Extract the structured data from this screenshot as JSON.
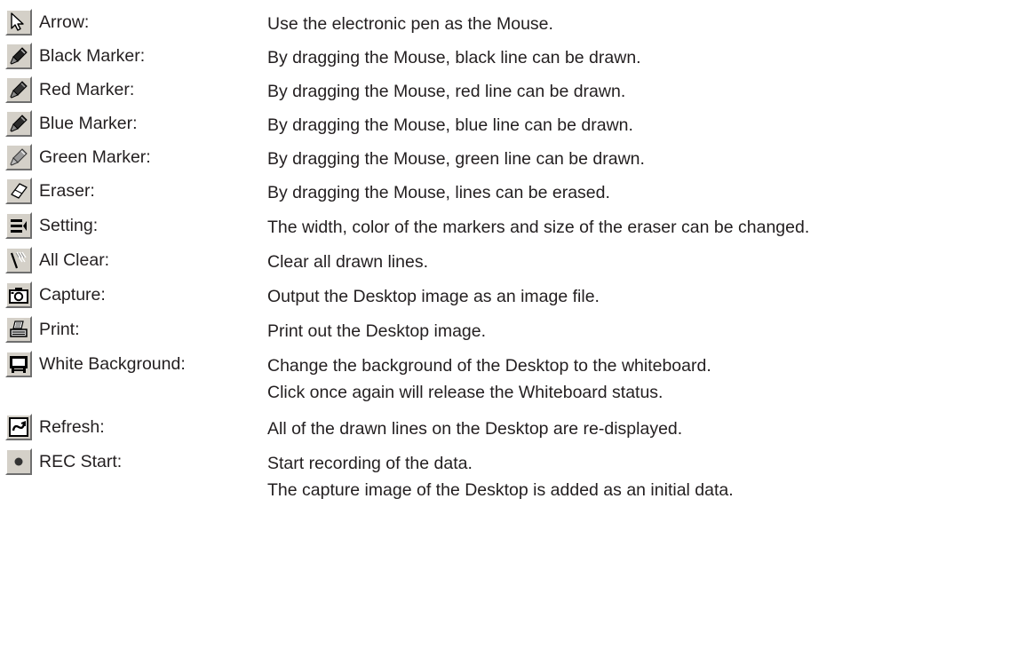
{
  "items": [
    {
      "icon": "arrow-cursor-icon",
      "label": "Arrow:",
      "desc": [
        "Use the electronic pen as the Mouse."
      ]
    },
    {
      "icon": "black-marker-icon",
      "label": "Black Marker:",
      "desc": [
        "By dragging the Mouse, black line can be drawn."
      ]
    },
    {
      "icon": "red-marker-icon",
      "label": "Red Marker:",
      "desc": [
        "By dragging the Mouse, red line can be drawn."
      ]
    },
    {
      "icon": "blue-marker-icon",
      "label": "Blue Marker:",
      "desc": [
        "By dragging the Mouse, blue line can be drawn."
      ]
    },
    {
      "icon": "green-marker-icon",
      "label": "Green Marker:",
      "desc": [
        "By dragging the Mouse, green line can be drawn."
      ]
    },
    {
      "icon": "eraser-icon",
      "label": "Eraser:",
      "desc": [
        "By dragging the Mouse, lines can be erased."
      ]
    },
    {
      "icon": "setting-icon",
      "label": "Setting:",
      "desc": [
        "The width, color of the markers and size of the eraser can be changed."
      ]
    },
    {
      "icon": "all-clear-icon",
      "label": "All Clear:",
      "desc": [
        "Clear all drawn lines."
      ]
    },
    {
      "icon": "camera-icon",
      "label": "Capture:",
      "desc": [
        "Output the Desktop image as an image file."
      ]
    },
    {
      "icon": "printer-icon",
      "label": "Print:",
      "desc": [
        "Print out the Desktop image."
      ]
    },
    {
      "icon": "whiteboard-icon",
      "label": "White Background:",
      "desc": [
        "Change the background of the Desktop to the whiteboard.",
        "Click once again will release the Whiteboard status."
      ]
    },
    {
      "icon": "refresh-icon",
      "label": "Refresh:",
      "desc": [
        "All of the drawn lines on the Desktop are re-displayed."
      ]
    },
    {
      "icon": "record-icon",
      "label": "REC Start:",
      "desc": [
        "Start recording of the data.",
        "The capture image of the Desktop is added as an initial data."
      ]
    }
  ]
}
